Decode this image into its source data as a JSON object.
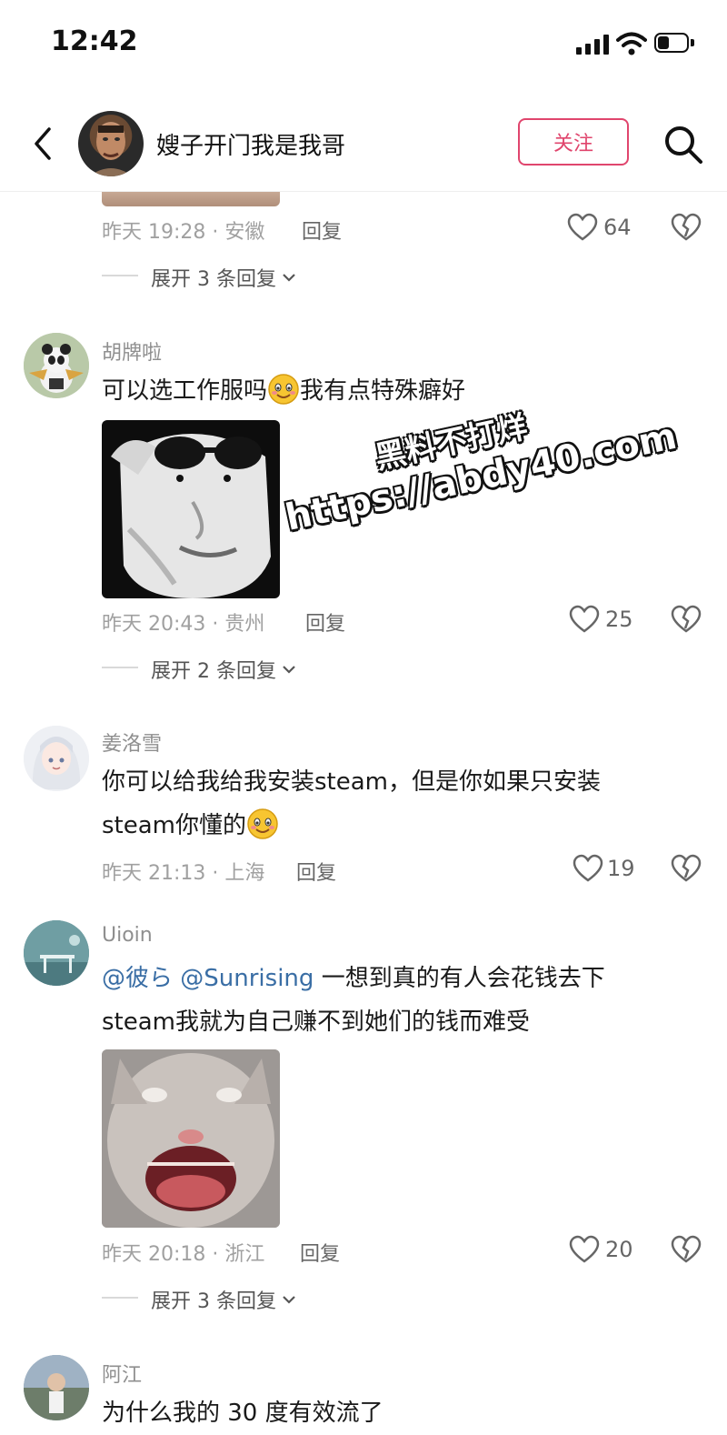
{
  "status_bar": {
    "time": "12:42"
  },
  "header": {
    "title": "嫂子开门我是我哥",
    "follow_label": "关注"
  },
  "top_comment": {
    "meta": "昨天 19:28 · 安徽",
    "reply_label": "回复",
    "likes": "64",
    "expand": "展开 3 条回复"
  },
  "comments": [
    {
      "name": "胡牌啦",
      "text_a": "可以选工作服吗",
      "text_b": "我有点特殊癖好",
      "meta": "昨天 20:43 · 贵州",
      "reply_label": "回复",
      "likes": "25",
      "expand": "展开 2 条回复"
    },
    {
      "name": "姜洛雪",
      "line1": "你可以给我给我安装steam，但是你如果只安装",
      "line2": "steam你懂的",
      "meta": "昨天 21:13 · 上海",
      "reply_label": "回复",
      "likes": "19"
    },
    {
      "name": "Uioin",
      "mention1": "@彼ら",
      "mention2": "@Sunrising",
      "line1_rest": "一想到真的有人会花钱去下",
      "line2": "steam我就为自己赚不到她们的钱而难受",
      "meta": "昨天 20:18 · 浙江",
      "reply_label": "回复",
      "likes": "20",
      "expand": "展开 3 条回复"
    },
    {
      "name": "阿江",
      "partial_text": "为什么我的 30 度有效流了"
    }
  ],
  "watermark": {
    "line1": "黑料不打烊",
    "line2": "https://abdy40.com"
  },
  "icons": [
    "back-arrow-icon",
    "search-icon",
    "heart-icon",
    "dislike-heart-icon",
    "smile-emoji-icon",
    "chevron-down-icon",
    "signal-icon",
    "wifi-icon",
    "battery-icon"
  ],
  "colors": {
    "accent": "#e0456d",
    "mention": "#3a6ea5",
    "meta_gray": "#a0a0a0"
  }
}
